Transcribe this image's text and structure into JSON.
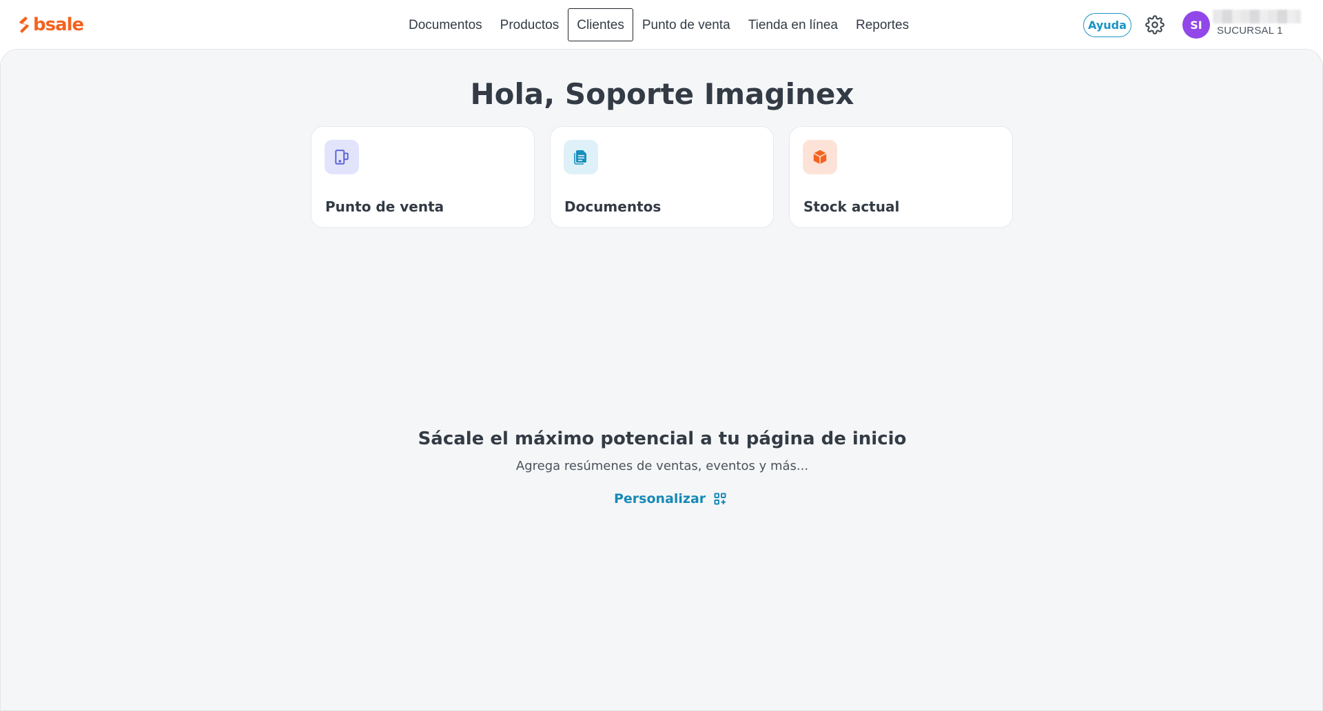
{
  "brand": {
    "logo_text": "bsale",
    "accent": "#f4621f",
    "logo_icon": "bsale-bolt-icon"
  },
  "nav": {
    "items": [
      {
        "label": "Documentos"
      },
      {
        "label": "Productos"
      },
      {
        "label": "Clientes",
        "active": true
      },
      {
        "label": "Punto de venta"
      },
      {
        "label": "Tienda en línea"
      },
      {
        "label": "Reportes"
      }
    ]
  },
  "header": {
    "help_label": "Ayuda",
    "settings_icon": "gear-icon",
    "avatar_initials": "SI",
    "avatar_color": "#9247e8",
    "branch": "SUCURSAL 1"
  },
  "main": {
    "greeting": "Hola, Soporte Imaginex",
    "shortcuts": [
      {
        "label": "Punto de venta",
        "icon": "pos-terminal-icon",
        "icon_bg": "#e2e4fb",
        "icon_color": "#5b63d9"
      },
      {
        "label": "Documentos",
        "icon": "document-icon",
        "icon_bg": "#dff1f8",
        "icon_color": "#1a8fbd"
      },
      {
        "label": "Stock actual",
        "icon": "box-icon",
        "icon_bg": "#fde3d7",
        "icon_color": "#f4621f"
      }
    ],
    "promo": {
      "title": "Sácale el máximo potencial a tu página de inicio",
      "subtitle": "Agrega resúmenes de ventas, eventos y más...",
      "link_label": "Personalizar",
      "link_icon": "grid-add-icon",
      "link_color": "#1689b6"
    }
  }
}
